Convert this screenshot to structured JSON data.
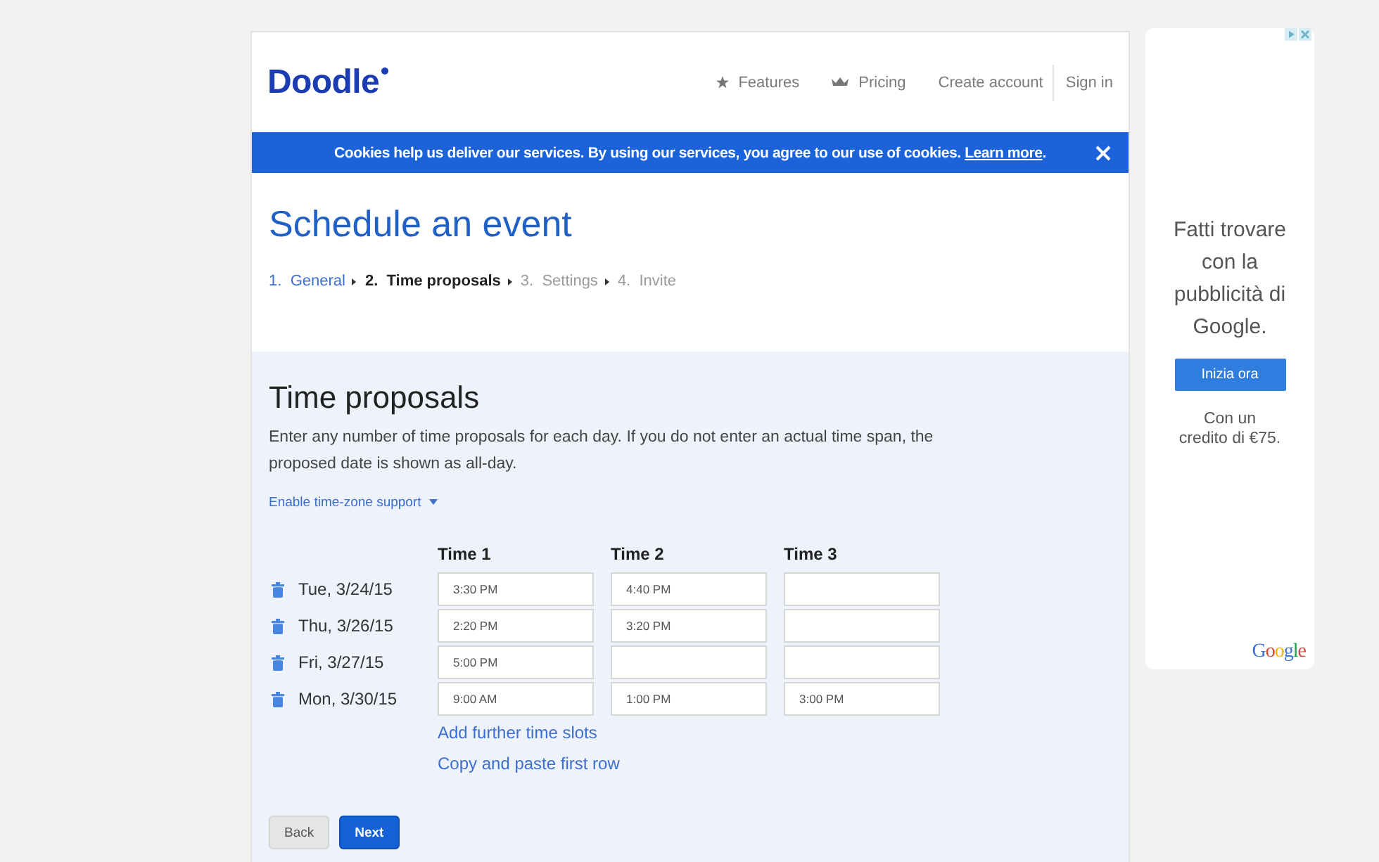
{
  "header": {
    "logo": "Doodle",
    "nav": [
      {
        "kind": "star",
        "label": "Features"
      },
      {
        "kind": "crown",
        "label": "Pricing"
      },
      {
        "kind": "plain",
        "label": "Create account"
      },
      {
        "kind": "divided",
        "label": "Sign in"
      }
    ]
  },
  "cookie_bar": {
    "message": "Cookies help us deliver our services. By using our services, you agree to our use of cookies.",
    "link": "Learn more",
    "link_suffix": "."
  },
  "page_title": "Schedule an event",
  "steps": [
    {
      "number": "1.",
      "label": "General",
      "completed": true,
      "selected": false
    },
    {
      "number": "2.",
      "label": "Time proposals",
      "completed": false,
      "selected": true
    },
    {
      "number": "3.",
      "label": "Settings",
      "completed": false,
      "selected": false
    },
    {
      "number": "4.",
      "label": "Invite",
      "completed": false,
      "selected": false
    }
  ],
  "section": {
    "heading": "Time proposals",
    "description": "Enter any number of time proposals for each day. If you do not enter an actual time span, the proposed date is shown as all-day.",
    "timezone_link": "Enable time-zone support"
  },
  "table": {
    "columns": [
      "Time 1",
      "Time 2",
      "Time 3"
    ],
    "rows": [
      {
        "date": "Tue, 3/24/15",
        "times": [
          "3:30 PM",
          "4:40 PM"
        ]
      },
      {
        "date": "Thu, 3/26/15",
        "times": [
          "2:20 PM",
          "3:20 PM"
        ]
      },
      {
        "date": "Fri, 3/27/15",
        "times": [
          "5:00 PM"
        ]
      },
      {
        "date": "Mon, 3/30/15",
        "times": [
          "9:00 AM",
          "1:00 PM",
          "3:00 PM"
        ]
      }
    ]
  },
  "links": [
    "Add further time slots",
    "Copy and paste first row"
  ],
  "buttons": [
    {
      "kind": "secondary",
      "label": "Back"
    },
    {
      "kind": "primary",
      "label": "Next"
    }
  ],
  "ad": {
    "text": "Fatti trovare con la pubblicità di Google.",
    "button": "Inizia ora",
    "note": "Con un credito di €75.",
    "logo": "Google"
  }
}
